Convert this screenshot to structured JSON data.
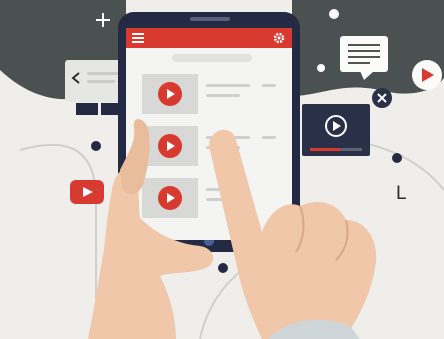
{
  "scene": {
    "palette": {
      "dark_band": "#4a5150",
      "phone_body": "#252a44",
      "accent_red": "#d83a2f",
      "skin": "#f0c7a8",
      "card": "#f4f4f2"
    },
    "letter_label": "L",
    "icons": [
      "plus-icon",
      "back-chevron-icon",
      "document-icon",
      "video-player-icon",
      "close-icon",
      "youtube-play-icon",
      "menu-icon",
      "gear-icon"
    ]
  }
}
